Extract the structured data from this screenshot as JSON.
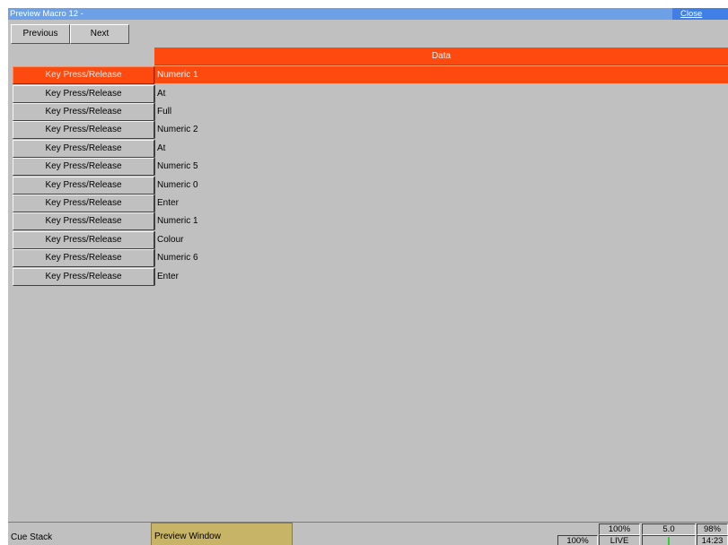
{
  "window": {
    "title": "Preview Macro 12 -",
    "close_label": "Close"
  },
  "toolbar": {
    "previous_label": "Previous",
    "next_label": "Next"
  },
  "table": {
    "data_header": "Data",
    "rows": [
      {
        "type": "Key Press/Release",
        "data": "Numeric 1",
        "selected": true
      },
      {
        "type": "Key Press/Release",
        "data": "At"
      },
      {
        "type": "Key Press/Release",
        "data": "Full"
      },
      {
        "type": "Key Press/Release",
        "data": "Numeric 2"
      },
      {
        "type": "Key Press/Release",
        "data": "At"
      },
      {
        "type": "Key Press/Release",
        "data": "Numeric 5"
      },
      {
        "type": "Key Press/Release",
        "data": "Numeric 0"
      },
      {
        "type": "Key Press/Release",
        "data": "Enter"
      },
      {
        "type": "Key Press/Release",
        "data": "Numeric 1"
      },
      {
        "type": "Key Press/Release",
        "data": "Colour"
      },
      {
        "type": "Key Press/Release",
        "data": "Numeric 6"
      },
      {
        "type": "Key Press/Release",
        "data": "Enter"
      }
    ]
  },
  "status": {
    "cue_stack_label": "Cue Stack",
    "preview_window_label": "Preview Window",
    "top_left": "100%",
    "top_mid": "5.0",
    "top_right": "98%",
    "bottom_left": "100%",
    "bottom_live": "LIVE",
    "bottom_right": "14:23"
  },
  "colors": {
    "accent": "#ff4a0f",
    "titlebar": "#6ea0e8",
    "preview_button": "#c8b466"
  }
}
